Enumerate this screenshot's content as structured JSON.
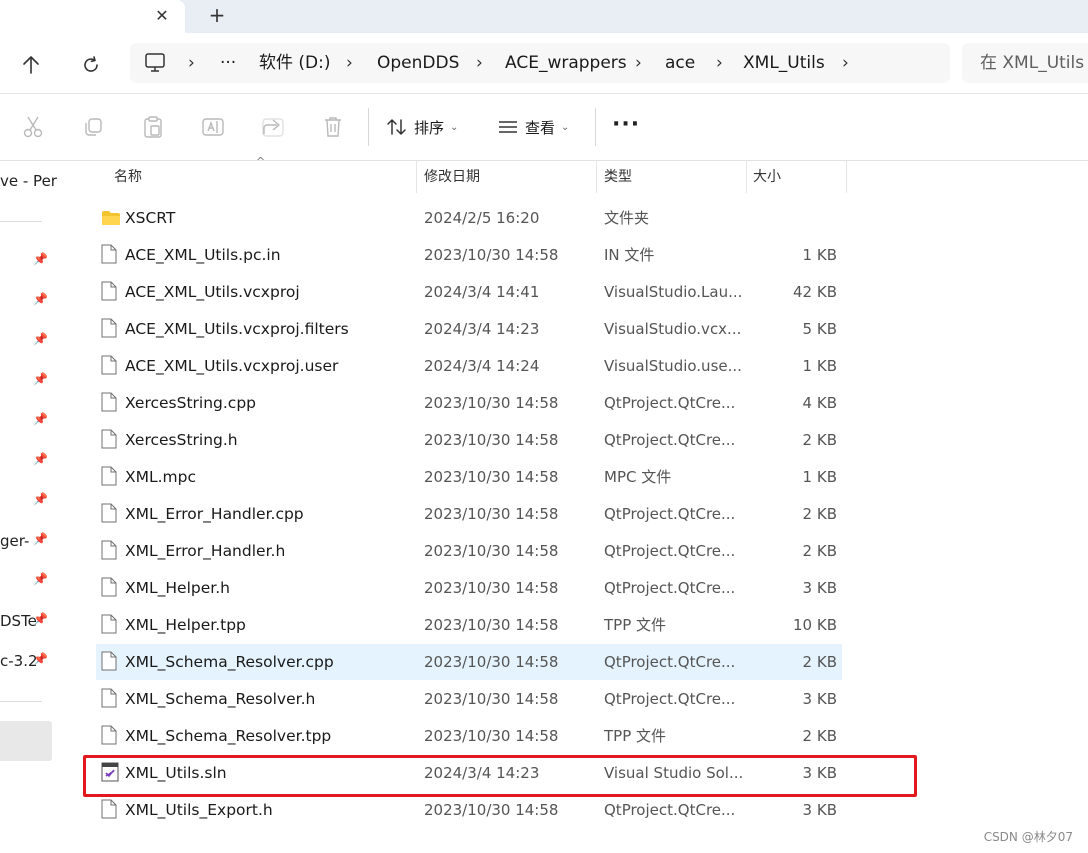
{
  "tabbar": {
    "close_glyph": "✕",
    "new_glyph": "+"
  },
  "address": {
    "ellipsis": "···",
    "breadcrumbs": [
      "软件 (D:)",
      "OpenDDS",
      "ACE_wrappers",
      "ace",
      "XML_Utils"
    ]
  },
  "search": {
    "placeholder": "在 XML_Utils 中搜索"
  },
  "toolbar": {
    "sort_label": "排序",
    "view_label": "查看",
    "more_label": "···"
  },
  "navpane": {
    "items": [
      "ve - Per",
      "ger-",
      "DSTe",
      "c-3.2"
    ]
  },
  "columns": {
    "name": "名称",
    "date": "修改日期",
    "type": "类型",
    "size": "大小"
  },
  "files": [
    {
      "name": "XSCRT",
      "date": "2024/2/5 16:20",
      "type": "文件夹",
      "size": "",
      "icon": "folder-icon"
    },
    {
      "name": "ACE_XML_Utils.pc.in",
      "date": "2023/10/30 14:58",
      "type": "IN 文件",
      "size": "1 KB",
      "icon": "file-icon"
    },
    {
      "name": "ACE_XML_Utils.vcxproj",
      "date": "2024/3/4 14:41",
      "type": "VisualStudio.Lau...",
      "size": "42 KB",
      "icon": "file-icon"
    },
    {
      "name": "ACE_XML_Utils.vcxproj.filters",
      "date": "2024/3/4 14:23",
      "type": "VisualStudio.vcx...",
      "size": "5 KB",
      "icon": "file-icon"
    },
    {
      "name": "ACE_XML_Utils.vcxproj.user",
      "date": "2024/3/4 14:24",
      "type": "VisualStudio.use...",
      "size": "1 KB",
      "icon": "file-icon"
    },
    {
      "name": "XercesString.cpp",
      "date": "2023/10/30 14:58",
      "type": "QtProject.QtCre...",
      "size": "4 KB",
      "icon": "file-icon"
    },
    {
      "name": "XercesString.h",
      "date": "2023/10/30 14:58",
      "type": "QtProject.QtCre...",
      "size": "2 KB",
      "icon": "file-icon"
    },
    {
      "name": "XML.mpc",
      "date": "2023/10/30 14:58",
      "type": "MPC 文件",
      "size": "1 KB",
      "icon": "file-icon"
    },
    {
      "name": "XML_Error_Handler.cpp",
      "date": "2023/10/30 14:58",
      "type": "QtProject.QtCre...",
      "size": "2 KB",
      "icon": "file-icon"
    },
    {
      "name": "XML_Error_Handler.h",
      "date": "2023/10/30 14:58",
      "type": "QtProject.QtCre...",
      "size": "2 KB",
      "icon": "file-icon"
    },
    {
      "name": "XML_Helper.h",
      "date": "2023/10/30 14:58",
      "type": "QtProject.QtCre...",
      "size": "3 KB",
      "icon": "file-icon"
    },
    {
      "name": "XML_Helper.tpp",
      "date": "2023/10/30 14:58",
      "type": "TPP 文件",
      "size": "10 KB",
      "icon": "file-icon"
    },
    {
      "name": "XML_Schema_Resolver.cpp",
      "date": "2023/10/30 14:58",
      "type": "QtProject.QtCre...",
      "size": "2 KB",
      "icon": "file-icon"
    },
    {
      "name": "XML_Schema_Resolver.h",
      "date": "2023/10/30 14:58",
      "type": "QtProject.QtCre...",
      "size": "3 KB",
      "icon": "file-icon"
    },
    {
      "name": "XML_Schema_Resolver.tpp",
      "date": "2023/10/30 14:58",
      "type": "TPP 文件",
      "size": "2 KB",
      "icon": "file-icon"
    },
    {
      "name": "XML_Utils.sln",
      "date": "2024/3/4 14:23",
      "type": "Visual Studio Sol...",
      "size": "3 KB",
      "icon": "vs-solution-icon"
    },
    {
      "name": "XML_Utils_Export.h",
      "date": "2023/10/30 14:58",
      "type": "QtProject.QtCre...",
      "size": "3 KB",
      "icon": "file-icon"
    }
  ],
  "watermark": "CSDN @林夕07",
  "colors": {
    "hover_row": "#e5f3ff",
    "highlight_box": "#e3171f",
    "folder": "#f4c430"
  }
}
